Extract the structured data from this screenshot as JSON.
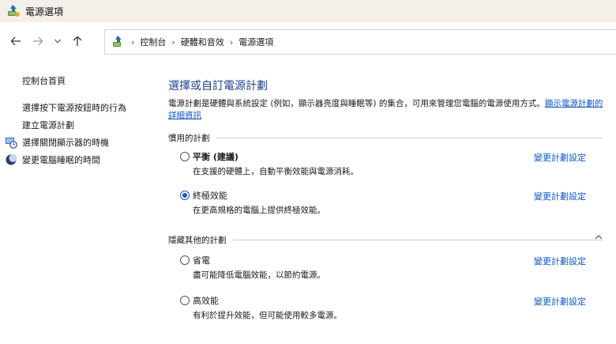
{
  "window": {
    "title": "電源選項",
    "icon": "power-options-icon"
  },
  "nav": {
    "back_icon": "arrow-left-icon",
    "forward_icon": "arrow-right-icon",
    "recent_icon": "chevron-down-icon",
    "up_icon": "arrow-up-icon"
  },
  "breadcrumb": {
    "items": [
      "控制台",
      "硬體和音效",
      "電源選項"
    ],
    "separator": "›"
  },
  "sidebar": {
    "home": "控制台首頁",
    "links": [
      "選擇按下電源按鈕時的行為",
      "建立電源計劃",
      "選擇關閉顯示器的時機",
      "變更電腦睡眠的時間"
    ]
  },
  "main": {
    "title": "選擇或自訂電源計劃",
    "description": "電源計劃是硬體與系統設定 (例如，顯示器亮度與睡眠等) 的集合，可用來管理您電腦的電源使用方式。",
    "learn_more": "顯示電源計劃的詳細資訊",
    "preferred_section": "慣用的計劃",
    "hidden_section": "隱藏其他的計劃",
    "change_label": "變更計劃設定",
    "preferred_plans": [
      {
        "name": "平衡 (建議)",
        "bold": true,
        "desc": "在支援的硬體上，自動平衡效能與電源消耗。",
        "selected": false
      },
      {
        "name": "終極效能",
        "bold": false,
        "desc": "在更高規格的電腦上提供終極效能。",
        "selected": true
      }
    ],
    "hidden_plans": [
      {
        "name": "省電",
        "desc": "盡可能降低電腦效能，以節約電源。",
        "selected": false
      },
      {
        "name": "高效能",
        "desc": "有利於提升效能，但可能使用較多電源。",
        "selected": false
      }
    ]
  },
  "colors": {
    "title_blue": "#1e3f8a",
    "link_blue": "#0b57c8",
    "titlebar_bg": "#f3efe9"
  }
}
